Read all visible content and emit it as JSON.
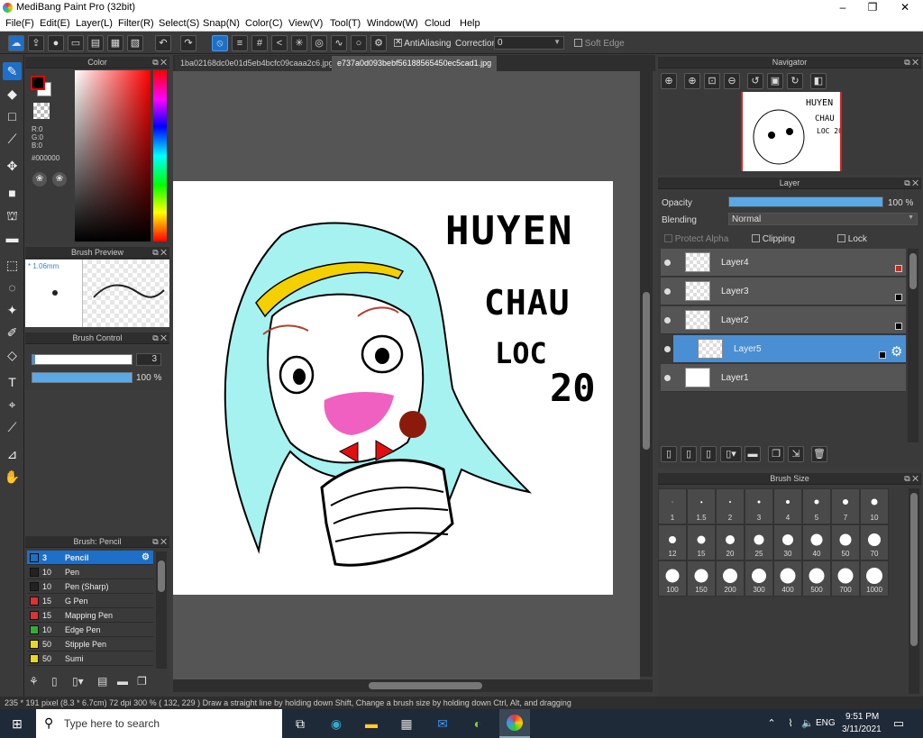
{
  "app": {
    "title": "MediBang Paint Pro (32bit)"
  },
  "menu": [
    "File(F)",
    "Edit(E)",
    "Layer(L)",
    "Filter(R)",
    "Select(S)",
    "Snap(N)",
    "Color(C)",
    "View(V)",
    "Tool(T)",
    "Window(W)",
    "Cloud",
    "Help"
  ],
  "toolbar": {
    "antialiasing_label": "AntiAliasing",
    "correction_label": "Correction",
    "correction_value": "0",
    "soft_edge_label": "Soft Edge"
  },
  "color_panel": {
    "title": "Color",
    "r": "R:0",
    "g": "G:0",
    "b": "B:0",
    "hex": "#000000",
    "primary_color": "#000000",
    "secondary_color": "#ffffff"
  },
  "brush_preview": {
    "title": "Brush Preview",
    "size": "* 1.06mm"
  },
  "brush_control": {
    "title": "Brush Control",
    "size_value": "3",
    "opacity_value": "100 %"
  },
  "brush_list": {
    "title": "Brush: Pencil",
    "items": [
      {
        "size": "3",
        "name": "Pencil",
        "color": "#1e6fc7"
      },
      {
        "size": "10",
        "name": "Pen",
        "color": "#222222"
      },
      {
        "size": "10",
        "name": "Pen (Sharp)",
        "color": "#222222"
      },
      {
        "size": "15",
        "name": "G Pen",
        "color": "#e03030"
      },
      {
        "size": "15",
        "name": "Mapping Pen",
        "color": "#e03030"
      },
      {
        "size": "10",
        "name": "Edge Pen",
        "color": "#30b030"
      },
      {
        "size": "50",
        "name": "Stipple Pen",
        "color": "#e8d820"
      },
      {
        "size": "50",
        "name": "Sumi",
        "color": "#e8d820"
      }
    ]
  },
  "tabs": [
    {
      "label": "1ba02168dc0e01d5eb4bcfc09caaa2c6.jpg"
    },
    {
      "label": "e737a0d093bebf56188565450ec5cad1.jpg"
    }
  ],
  "navigator": {
    "title": "Navigator"
  },
  "layer_panel": {
    "title": "Layer",
    "opacity_label": "Opacity",
    "opacity_value": "100 %",
    "opacity_fraction": 1.0,
    "blending_label": "Blending",
    "blending_value": "Normal",
    "protect_alpha": "Protect Alpha",
    "clipping": "Clipping",
    "lock": "Lock",
    "layers": [
      {
        "name": "Layer4",
        "mark": "#c03020"
      },
      {
        "name": "Layer3",
        "mark": "#000000"
      },
      {
        "name": "Layer2",
        "mark": "#000000"
      },
      {
        "name": "Layer5",
        "mark": "#000000"
      },
      {
        "name": "Layer1",
        "mark": ""
      }
    ]
  },
  "brush_size": {
    "title": "Brush Size",
    "sizes": [
      "1",
      "1.5",
      "2",
      "3",
      "4",
      "5",
      "7",
      "10",
      "12",
      "15",
      "20",
      "25",
      "30",
      "40",
      "50",
      "70",
      "100",
      "150",
      "200",
      "300",
      "400",
      "500",
      "700",
      "1000"
    ]
  },
  "canvas_text": {
    "line1": "HUYEN",
    "line2": "CHAU",
    "line3": "LOC",
    "line4": "20"
  },
  "status": {
    "text": "235 * 191 pixel  (8.3 * 6.7cm)  72 dpi  300 %  ( 132, 229 )  Draw a straight line by holding down Shift, Change a brush size by holding down Ctrl, Alt, and dragging"
  },
  "taskbar": {
    "search_placeholder": "Type here to search",
    "lang": "ENG",
    "time": "9:51 PM",
    "date": "3/11/2021"
  }
}
